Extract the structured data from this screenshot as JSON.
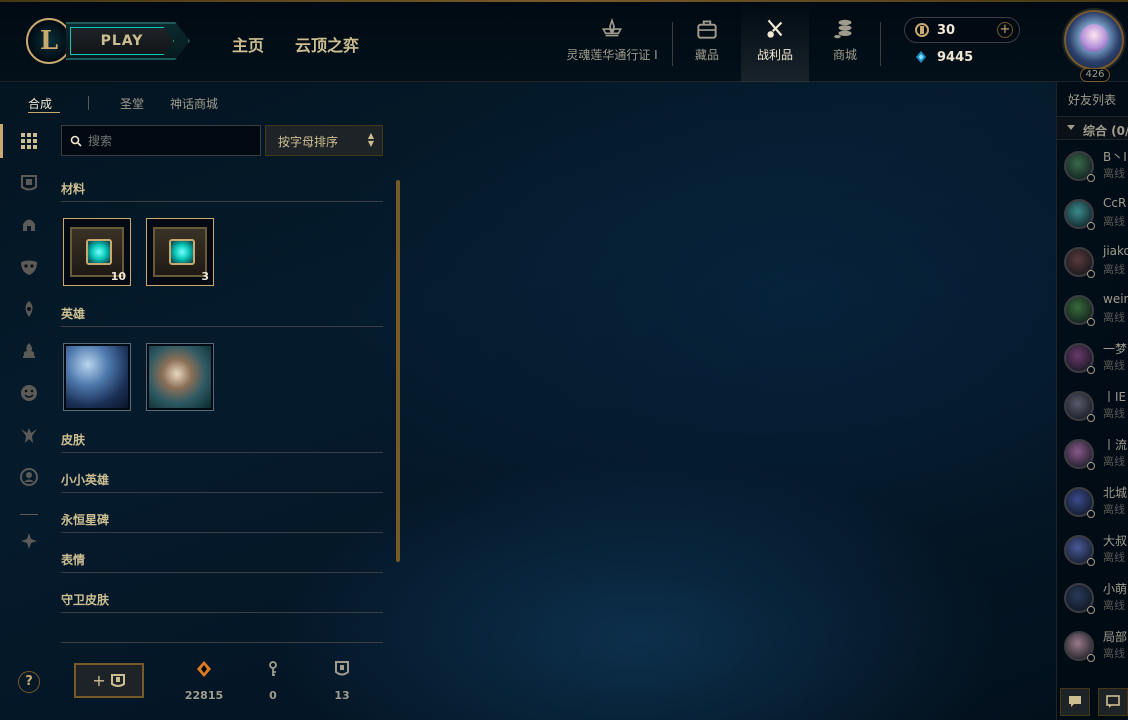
{
  "header": {
    "logo_letter": "L",
    "play_label": "PLAY",
    "nav": [
      "主页",
      "云顶之弈"
    ],
    "icons": [
      {
        "label": "灵魂莲华通行证 I",
        "icon": "lotus-icon"
      },
      {
        "label": "藏品",
        "icon": "collection-bag-icon"
      },
      {
        "label": "战利品",
        "icon": "loot-icon",
        "active": true
      },
      {
        "label": "商城",
        "icon": "coins-stack-icon"
      }
    ],
    "rp": "30",
    "be": "9445",
    "level": "426"
  },
  "subtabs": [
    {
      "label": "合成",
      "active": true
    },
    {
      "label": "圣堂",
      "active": false
    },
    {
      "label": "神话商城",
      "active": false
    }
  ],
  "search": {
    "placeholder": "搜索"
  },
  "sort": {
    "label": "按字母排序"
  },
  "categories": {
    "materials": {
      "title": "材料",
      "items": [
        {
          "count": "10"
        },
        {
          "count": "3"
        }
      ]
    },
    "champions": {
      "title": "英雄"
    },
    "skins": {
      "title": "皮肤"
    },
    "tft_little_legends": {
      "title": "小小英雄"
    },
    "eternals": {
      "title": "永恒星碑"
    },
    "emotes": {
      "title": "表情"
    },
    "ward_skins": {
      "title": "守卫皮肤"
    }
  },
  "bottom": {
    "craft_plus": "+",
    "orange_essence": "22815",
    "keys": "0",
    "chests": "13"
  },
  "help": "?",
  "friends": {
    "title": "好友列表",
    "group": "综合 (0/",
    "list": [
      {
        "name": "B丶I",
        "status": "离线",
        "color": "#3a6a4a"
      },
      {
        "name": "CcR",
        "status": "离线",
        "color": "#3a8a8a"
      },
      {
        "name": "jiako",
        "status": "离线",
        "color": "#5a3a3a"
      },
      {
        "name": "weir",
        "status": "离线",
        "color": "#3a6a3a"
      },
      {
        "name": "一梦",
        "status": "离线",
        "color": "#6a3a6a"
      },
      {
        "name": "丨IE",
        "status": "离线",
        "color": "#5a5a6a"
      },
      {
        "name": "丨流",
        "status": "离线",
        "color": "#8a5a8a"
      },
      {
        "name": "北城",
        "status": "离线",
        "color": "#3a4a8a"
      },
      {
        "name": "大叔",
        "status": "离线",
        "color": "#4a5a9a"
      },
      {
        "name": "小萌",
        "status": "离线",
        "color": "#2a3a5a"
      },
      {
        "name": "局部",
        "status": "离线",
        "color": "#9a7a8a"
      }
    ]
  },
  "colors": {
    "gold": "#c8aa6e",
    "gold_dark": "#785a28",
    "teal": "#0ac8b9",
    "text": "#a09b8c",
    "text_light": "#f0e6d2"
  }
}
